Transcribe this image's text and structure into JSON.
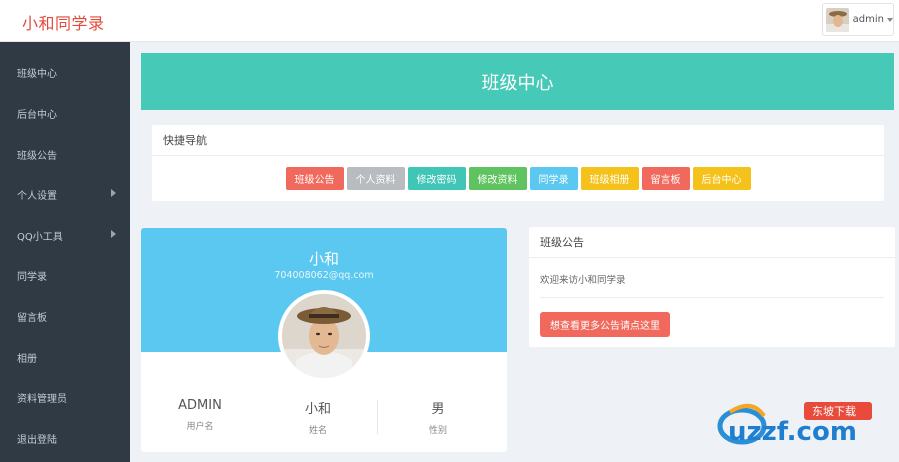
{
  "header": {
    "brand": "小和同学录",
    "user": "admin"
  },
  "sidebar": {
    "items": [
      {
        "label": "班级中心",
        "has_submenu": false
      },
      {
        "label": "后台中心",
        "has_submenu": false
      },
      {
        "label": "班级公告",
        "has_submenu": false
      },
      {
        "label": "个人设置",
        "has_submenu": true
      },
      {
        "label": "QQ小工具",
        "has_submenu": true
      },
      {
        "label": "同学录",
        "has_submenu": false
      },
      {
        "label": "留言板",
        "has_submenu": false
      },
      {
        "label": "相册",
        "has_submenu": false
      },
      {
        "label": "资料管理员",
        "has_submenu": false
      },
      {
        "label": "退出登陆",
        "has_submenu": false
      }
    ]
  },
  "banner": {
    "title": "班级中心",
    "color": "#47c9b8"
  },
  "quick_nav": {
    "title": "快捷导航",
    "buttons": [
      {
        "label": "班级公告",
        "color": "#f0695c"
      },
      {
        "label": "个人资料",
        "color": "#b8bcc0"
      },
      {
        "label": "修改密码",
        "color": "#3fc6b6"
      },
      {
        "label": "修改资料",
        "color": "#5fc35f"
      },
      {
        "label": "同学录",
        "color": "#5ac8f0"
      },
      {
        "label": "班级相册",
        "color": "#f5c21b"
      },
      {
        "label": "留言板",
        "color": "#f0695c"
      },
      {
        "label": "后台中心",
        "color": "#f5c21b"
      }
    ]
  },
  "profile": {
    "name": "小和",
    "email": "704008062@qq.com",
    "stats": [
      {
        "value": "ADMIN",
        "key": "用户名"
      },
      {
        "value": "小和",
        "key": "姓名"
      },
      {
        "value": "男",
        "key": "性别"
      }
    ]
  },
  "notice": {
    "title": "班级公告",
    "text": "欢迎来访小和同学录",
    "button": "想查看更多公告请点这里"
  },
  "watermark": {
    "main": "uzzf.com",
    "badge": "东坡下载"
  }
}
